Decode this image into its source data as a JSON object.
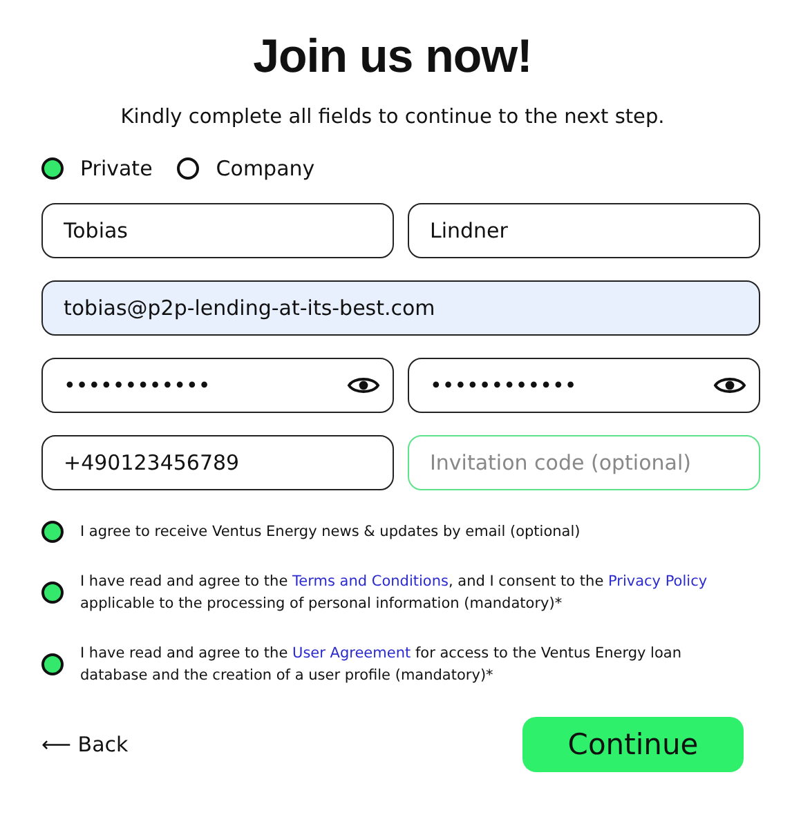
{
  "title": "Join us now!",
  "subtitle": "Kindly complete all fields to continue to the next step.",
  "account_type": [
    {
      "label": "Private",
      "selected": true
    },
    {
      "label": "Company",
      "selected": false
    }
  ],
  "fields": [
    {
      "kind": "text",
      "value": "Tobias",
      "highlighted": false,
      "focused": false
    },
    {
      "kind": "text",
      "value": "Lindner",
      "highlighted": false,
      "focused": false
    },
    {
      "kind": "wide",
      "value": "tobias@p2p-lending-at-its-best.com",
      "highlighted": true,
      "focused": false
    },
    {
      "kind": "password",
      "value": "••••••••••••",
      "highlighted": false,
      "focused": false
    },
    {
      "kind": "password",
      "value": "••••••••••••",
      "highlighted": false,
      "focused": false
    },
    {
      "kind": "text",
      "value": "+490123456789",
      "highlighted": false,
      "focused": false
    },
    {
      "kind": "text",
      "placeholder": "Invitation code (optional)",
      "highlighted": false,
      "focused": true
    }
  ],
  "consents": [
    {
      "checked": true,
      "parts": [
        {
          "kind": "text",
          "text": "I agree to receive Ventus Energy news & updates by email (optional)"
        }
      ]
    },
    {
      "checked": true,
      "parts": [
        {
          "kind": "text",
          "text": "I have read and agree to the "
        },
        {
          "kind": "link",
          "text": "Terms and Conditions"
        },
        {
          "kind": "text",
          "text": ", and I consent to the "
        },
        {
          "kind": "link",
          "text": "Privacy Policy"
        },
        {
          "kind": "text",
          "text": " applicable to the processing of personal information (mandatory)*"
        }
      ]
    },
    {
      "checked": true,
      "parts": [
        {
          "kind": "text",
          "text": "I have read and agree to the "
        },
        {
          "kind": "link",
          "text": "User Agreement"
        },
        {
          "kind": "text",
          "text": " for access to the Ventus Energy loan database and the creation of a user profile (mandatory)*"
        }
      ]
    }
  ],
  "back": "⟵ Back",
  "continue": "Continue"
}
